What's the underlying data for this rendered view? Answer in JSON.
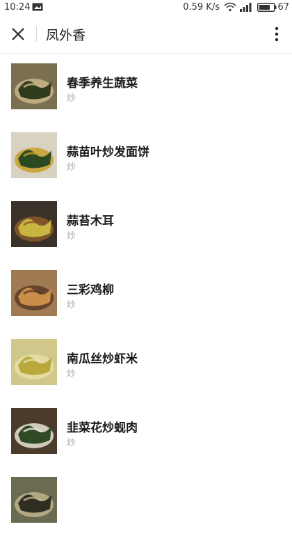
{
  "status_bar": {
    "time": "10:24",
    "speed": "0.59 K/s",
    "battery": "67"
  },
  "app_bar": {
    "title": "凤外香"
  },
  "recipes": [
    {
      "name": "春季养生蔬菜",
      "tag": "炒",
      "thumb": {
        "bg": "#7a6f4e",
        "accent": "#2f3b1d",
        "accent2": "#c9b58a"
      }
    },
    {
      "name": "蒜苗叶炒发面饼",
      "tag": "炒",
      "thumb": {
        "bg": "#d8d2c2",
        "accent": "#2c4a22",
        "accent2": "#c9a02a"
      }
    },
    {
      "name": "蒜苔木耳",
      "tag": "炒",
      "thumb": {
        "bg": "#3a3228",
        "accent": "#c8b640",
        "accent2": "#8c5a2a"
      }
    },
    {
      "name": "三彩鸡柳",
      "tag": "炒",
      "thumb": {
        "bg": "#a07a52",
        "accent": "#c98e4a",
        "accent2": "#5b3c22"
      }
    },
    {
      "name": "南瓜丝炒虾米",
      "tag": "炒",
      "thumb": {
        "bg": "#cfc88a",
        "accent": "#b9a83c",
        "accent2": "#e6dfa6"
      }
    },
    {
      "name": "韭菜花炒蚬肉",
      "tag": "炒",
      "thumb": {
        "bg": "#4a3b2a",
        "accent": "#2f4a24",
        "accent2": "#e9e4d6"
      }
    },
    {
      "name": "",
      "tag": "",
      "thumb": {
        "bg": "#6b6b52",
        "accent": "#2e2e22",
        "accent2": "#bdb38a"
      }
    }
  ]
}
